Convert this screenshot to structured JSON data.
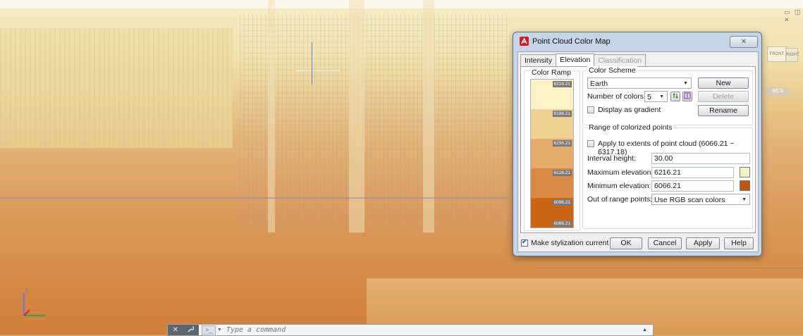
{
  "viewport": {
    "window_controls": "▭ ◫ ✕",
    "viewcube_face_1": "FRONT",
    "viewcube_face_2": "RIGHT",
    "wcs_label": "WCS"
  },
  "command_line": {
    "close_glyph": "✕",
    "wrench_glyph": "🔧",
    "prompt_glyph": ">_",
    "dropdown_glyph": "▼",
    "placeholder": "Type a command",
    "expand_glyph": "▲"
  },
  "dialog": {
    "title": "Point Cloud Color Map",
    "close_glyph": "✕",
    "tabs": [
      {
        "label": "Intensity",
        "state": "normal"
      },
      {
        "label": "Elevation",
        "state": "active"
      },
      {
        "label": "Classification",
        "state": "disabled"
      }
    ],
    "color_ramp": {
      "legend": "Color Ramp",
      "bands": [
        {
          "color": "#fbf3c7",
          "label": "6216.21"
        },
        {
          "color": "#efd196",
          "label": "6186.21"
        },
        {
          "color": "#e6ac6c",
          "label": "6156.21"
        },
        {
          "color": "#db8a45",
          "label": "6126.21"
        },
        {
          "color": "#cc6614",
          "label": "6096.21"
        }
      ],
      "bottom_label": "6066.21"
    },
    "color_scheme": {
      "legend": "Color Scheme",
      "selected": "Earth",
      "number_of_colors_label": "Number of colors:",
      "number_of_colors_value": "5",
      "display_gradient_label": "Display as gradient",
      "display_gradient_checked": false,
      "new_button": "New",
      "delete_button": "Delete",
      "rename_button": "Rename"
    },
    "range": {
      "legend": "Range of colorized points",
      "apply_extents_label": "Apply to extents of point cloud  (6066.21 ~ 6317.18)",
      "apply_extents_checked": false,
      "interval_height_label": "Interval height:",
      "interval_height_value": "30.00",
      "max_elevation_label": "Maximum elevation:",
      "max_elevation_value": "6216.21",
      "max_color": "#fbf0c0",
      "min_elevation_label": "Minimum elevation:",
      "min_elevation_value": "6066.21",
      "min_color": "#c0560c",
      "out_of_range_label": "Out of range points:",
      "out_of_range_value": "Use RGB scan colors"
    },
    "bottom": {
      "make_current_label": "Make stylization current",
      "make_current_checked": true,
      "ok": "OK",
      "cancel": "Cancel",
      "apply": "Apply",
      "help": "Help"
    }
  }
}
